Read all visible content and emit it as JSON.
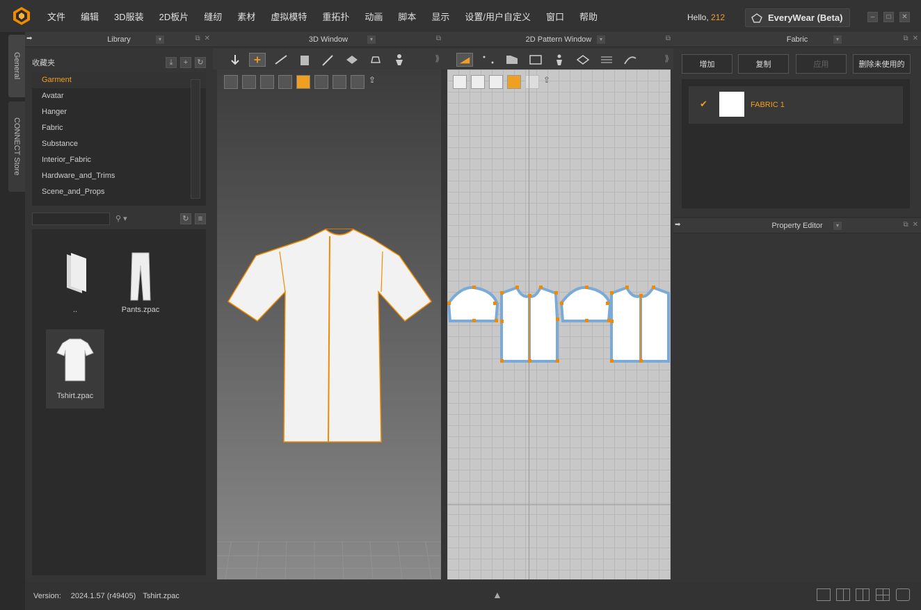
{
  "menubar": {
    "items": [
      "文件",
      "编辑",
      "3D服装",
      "2D板片",
      "缝纫",
      "素材",
      "虚拟模特",
      "重拓扑",
      "动画",
      "脚本",
      "显示",
      "设置/用户自定义",
      "窗口",
      "帮助"
    ],
    "hello_label": "Hello,",
    "hello_user": "212",
    "everywear_label": "EveryWear (Beta)"
  },
  "sidetabs": {
    "general": "General",
    "connect": "CONNECT Store"
  },
  "library": {
    "title": "Library",
    "section_label": "收藏夹",
    "items": [
      "Garment",
      "Avatar",
      "Hanger",
      "Fabric",
      "Substance",
      "Interior_Fabric",
      "Hardware_and_Trims",
      "Scene_and_Props"
    ],
    "active_item": "Garment",
    "search_value": "",
    "files": [
      {
        "name": "..",
        "icon": "folder-icon"
      },
      {
        "name": "Pants.zpac",
        "icon": "pants-icon"
      },
      {
        "name": "Tshirt.zpac",
        "icon": "tshirt-icon"
      }
    ]
  },
  "window3d": {
    "title": "3D Window"
  },
  "window2d": {
    "title": "2D Pattern Window"
  },
  "fabric": {
    "title": "Fabric",
    "buttons": [
      "增加",
      "复制",
      "应用",
      "删除未使用的"
    ],
    "items": [
      {
        "name": "FABRIC 1",
        "color": "#ffffff"
      }
    ]
  },
  "property_editor": {
    "title": "Property Editor"
  },
  "status": {
    "version_label": "Version:",
    "version_value": "2024.1.57 (r49405)",
    "file_name": "Tshirt.zpac"
  },
  "colors": {
    "accent": "#f0a020",
    "pattern_outline": "#7aaad8",
    "seam": "#f08a00"
  }
}
